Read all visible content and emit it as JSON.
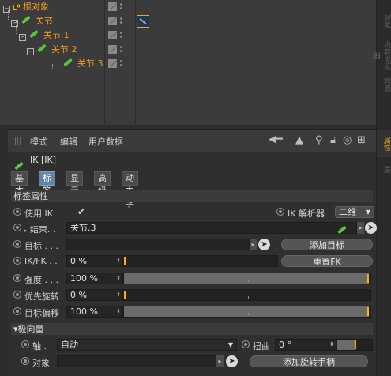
{
  "object_tree": {
    "items": [
      {
        "label": "根对象",
        "level": 0,
        "kind": "null"
      },
      {
        "label": "关节",
        "level": 1,
        "kind": "joint"
      },
      {
        "label": "关节.1",
        "level": 2,
        "kind": "joint"
      },
      {
        "label": "关节.2",
        "level": 3,
        "kind": "joint"
      },
      {
        "label": "关节.3",
        "level": 4,
        "kind": "joint"
      }
    ]
  },
  "right_tabs": [
    "对象",
    "内容浏览器",
    "构造",
    "属性",
    "层"
  ],
  "menu": {
    "items": [
      "模式",
      "编辑",
      "用户数据"
    ]
  },
  "header": {
    "title": "IK [IK]"
  },
  "tabs": [
    {
      "label": "基本",
      "active": false
    },
    {
      "label": "标签",
      "active": true
    },
    {
      "label": "显示",
      "active": false
    },
    {
      "label": "高级",
      "active": false
    },
    {
      "label": "动力学",
      "active": false
    }
  ],
  "tag_props": {
    "section_title": "标签属性",
    "use_ik_label": "使用 IK",
    "use_ik_value": "✔",
    "solver_label": "IK 解析器",
    "solver_value": "二维",
    "end_label": "结束. .",
    "end_value": "关节.3",
    "target_label": "目标 . . .",
    "add_target_label": "添加目标",
    "ikfk_label": "IK/FK . .",
    "ikfk_value": "0 %",
    "ikfk_fraction": 0.0,
    "reset_fk_label": "重置FK",
    "strength_label": "强度 . . .",
    "strength_value": "100 %",
    "strength_fraction": 1.0,
    "pref_rot_label": "优先旋转",
    "pref_rot_value": "0 %",
    "pref_rot_fraction": 0.0,
    "target_offset_label": "目标偏移",
    "target_offset_value": "100 %",
    "target_offset_fraction": 1.0
  },
  "pole": {
    "section_title": "▾极向量",
    "axis_label": "轴 .",
    "axis_value": "自动",
    "twist_label": "扭曲",
    "twist_value": "0 °",
    "object_label": "对象",
    "add_pole_label": "添加旋转手柄"
  },
  "colors": {
    "accent_orange": "#f09a1e",
    "active_tab": "#6383a8",
    "bone_green": "#5ac43c"
  }
}
